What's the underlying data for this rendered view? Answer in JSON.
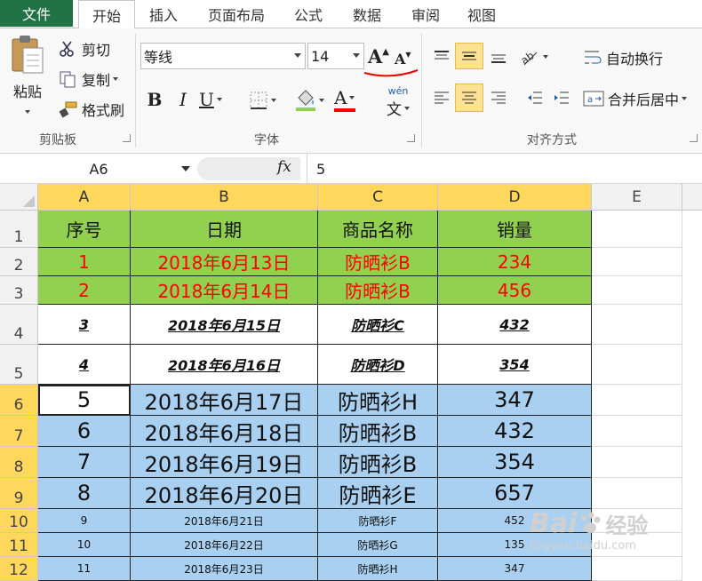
{
  "ribbon_tabs": {
    "file": "文件",
    "home": "开始",
    "insert": "插入",
    "layout": "页面布局",
    "formulas": "公式",
    "data": "数据",
    "review": "审阅",
    "view": "视图"
  },
  "clipboard": {
    "paste": "粘贴",
    "cut": "剪切",
    "copy": "复制",
    "format_painter": "格式刷",
    "group_label": "剪贴板"
  },
  "font": {
    "name": "等线",
    "size": "14",
    "grow": "A",
    "shrink": "A",
    "bold": "B",
    "italic": "I",
    "underline": "U",
    "font_color_letter": "A",
    "phonetic": "文",
    "group_label": "字体"
  },
  "alignment": {
    "wrap_text": "自动换行",
    "merge_center": "合并后居中",
    "group_label": "对齐方式"
  },
  "formula_bar": {
    "name_box": "A6",
    "fx": "fx",
    "value": "5"
  },
  "grid": {
    "columns": [
      "A",
      "B",
      "C",
      "D",
      "E"
    ],
    "rows": [
      "1",
      "2",
      "3",
      "4",
      "5",
      "6",
      "7",
      "8",
      "9",
      "10",
      "11",
      "12"
    ],
    "header": [
      "序号",
      "日期",
      "商品名称",
      "销量"
    ],
    "data": [
      [
        "1",
        "2018年6月13日",
        "防晒衫B",
        "234"
      ],
      [
        "2",
        "2018年6月14日",
        "防晒衫B",
        "456"
      ],
      [
        "3",
        "2018年6月15日",
        "防晒衫C",
        "432"
      ],
      [
        "4",
        "2018年6月16日",
        "防晒衫D",
        "354"
      ],
      [
        "5",
        "2018年6月17日",
        "防晒衫H",
        "347"
      ],
      [
        "6",
        "2018年6月18日",
        "防晒衫B",
        "432"
      ],
      [
        "7",
        "2018年6月19日",
        "防晒衫B",
        "354"
      ],
      [
        "8",
        "2018年6月20日",
        "防晒衫E",
        "657"
      ],
      [
        "9",
        "2018年6月21日",
        "防晒衫F",
        "452"
      ],
      [
        "10",
        "2018年6月22日",
        "防晒衫G",
        "135"
      ],
      [
        "11",
        "2018年6月23日",
        "防晒衫H",
        "347"
      ]
    ]
  },
  "watermark": {
    "brand": "Bai",
    "brand2": "经验",
    "url": "jingyan.baidu.com"
  },
  "colors": {
    "file_tab": "#217346",
    "header_fill": "#92d050",
    "selection_fill": "#a9d0f0",
    "selected_header": "#ffd75c"
  }
}
